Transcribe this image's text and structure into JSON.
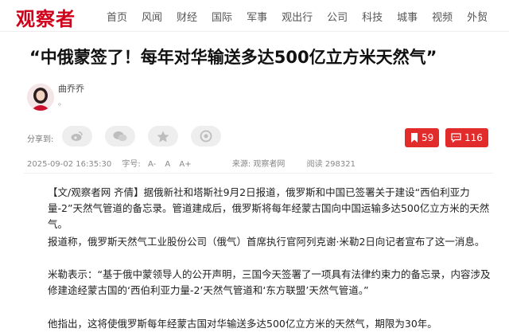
{
  "header": {
    "logo_text": "观察者",
    "nav": [
      "首页",
      "风闻",
      "财经",
      "国际",
      "军事",
      "观出行",
      "公司",
      "科技",
      "城事",
      "视频",
      "外贸"
    ]
  },
  "article": {
    "title": "“中俄蒙签了！每年对华输送多达500亿立方米天然气”",
    "author": "曲乔乔",
    "author_sub": "。",
    "share_label": "分享到:",
    "share_icons": [
      "weibo-icon",
      "wechat-icon",
      "qzone-icon",
      "moments-icon"
    ],
    "bookmark_count": "59",
    "comment_count": "116",
    "date": "2025-09-02 16:35:30",
    "font_label": "字号:",
    "font_smaller": "A-",
    "font_normal": "A",
    "font_bigger": "A+",
    "source": "来源: 观察者网",
    "views": "阅读 298321",
    "paragraphs": [
      "【文/观察者网 齐倩】据俄新社和塔斯社9月2日报道，俄罗斯和中国已签署关于建设“西伯利亚力量-2”天然气管道的备忘录。管道建成后，俄罗斯将每年经蒙古国向中国运输多达500亿立方米的天然气。",
      "报道称，俄罗斯天然气工业股份公司（俄气）首席执行官阿列克谢·米勒2日向记者宣布了这一消息。",
      "米勒表示：“基于俄中蒙领导人的公开声明，三国今天签署了一项具有法律约束力的备忘录，内容涉及修建途经蒙古国的‘西伯利亚力量-2’天然气管道和‘东方联盟’天然气管道。”",
      "他指出，这将使俄罗斯每年经蒙古国对华输送多达500亿立方米的天然气，期限为30年。"
    ]
  },
  "colors": {
    "brand": "#d0021b",
    "badge": "#e22c2c"
  }
}
